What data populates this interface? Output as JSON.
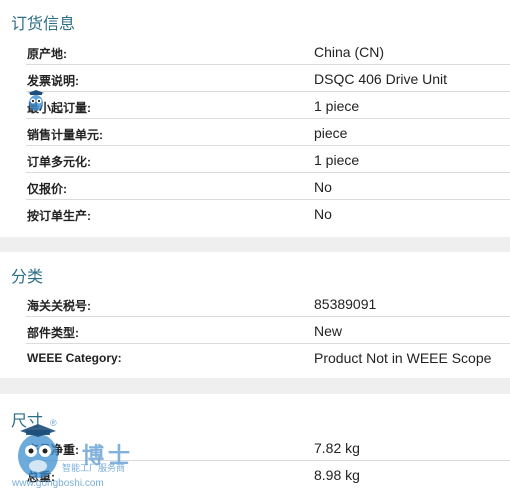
{
  "sections": [
    {
      "title": "订货信息",
      "rows": [
        {
          "label": "原产地:",
          "value": "China (CN)"
        },
        {
          "label": "发票说明:",
          "value": "DSQC 406 Drive Unit"
        },
        {
          "label": "最小起订量:",
          "value": "1 piece"
        },
        {
          "label": "销售计量单元:",
          "value": "piece"
        },
        {
          "label": "订单多元化:",
          "value": "1 piece"
        },
        {
          "label": "仅报价:",
          "value": "No"
        },
        {
          "label": "按订单生产:",
          "value": "No"
        }
      ]
    },
    {
      "title": "分类",
      "rows": [
        {
          "label": "海关关税号:",
          "value": "85389091"
        },
        {
          "label": "部件类型:",
          "value": "New"
        },
        {
          "label": "WEEE Category:",
          "value": "Product Not in WEEE Scope"
        }
      ]
    },
    {
      "title": "尺寸",
      "rows": [
        {
          "label": "产品净重:",
          "value": "7.82 kg"
        },
        {
          "label": "总重:",
          "value": "8.98 kg"
        }
      ]
    }
  ],
  "watermark": {
    "brand": "博士",
    "tagline": "智能工厂服务商",
    "url": "www.gongboshi.com",
    "registered": "®",
    "icon": "owl-mascot-icon"
  }
}
